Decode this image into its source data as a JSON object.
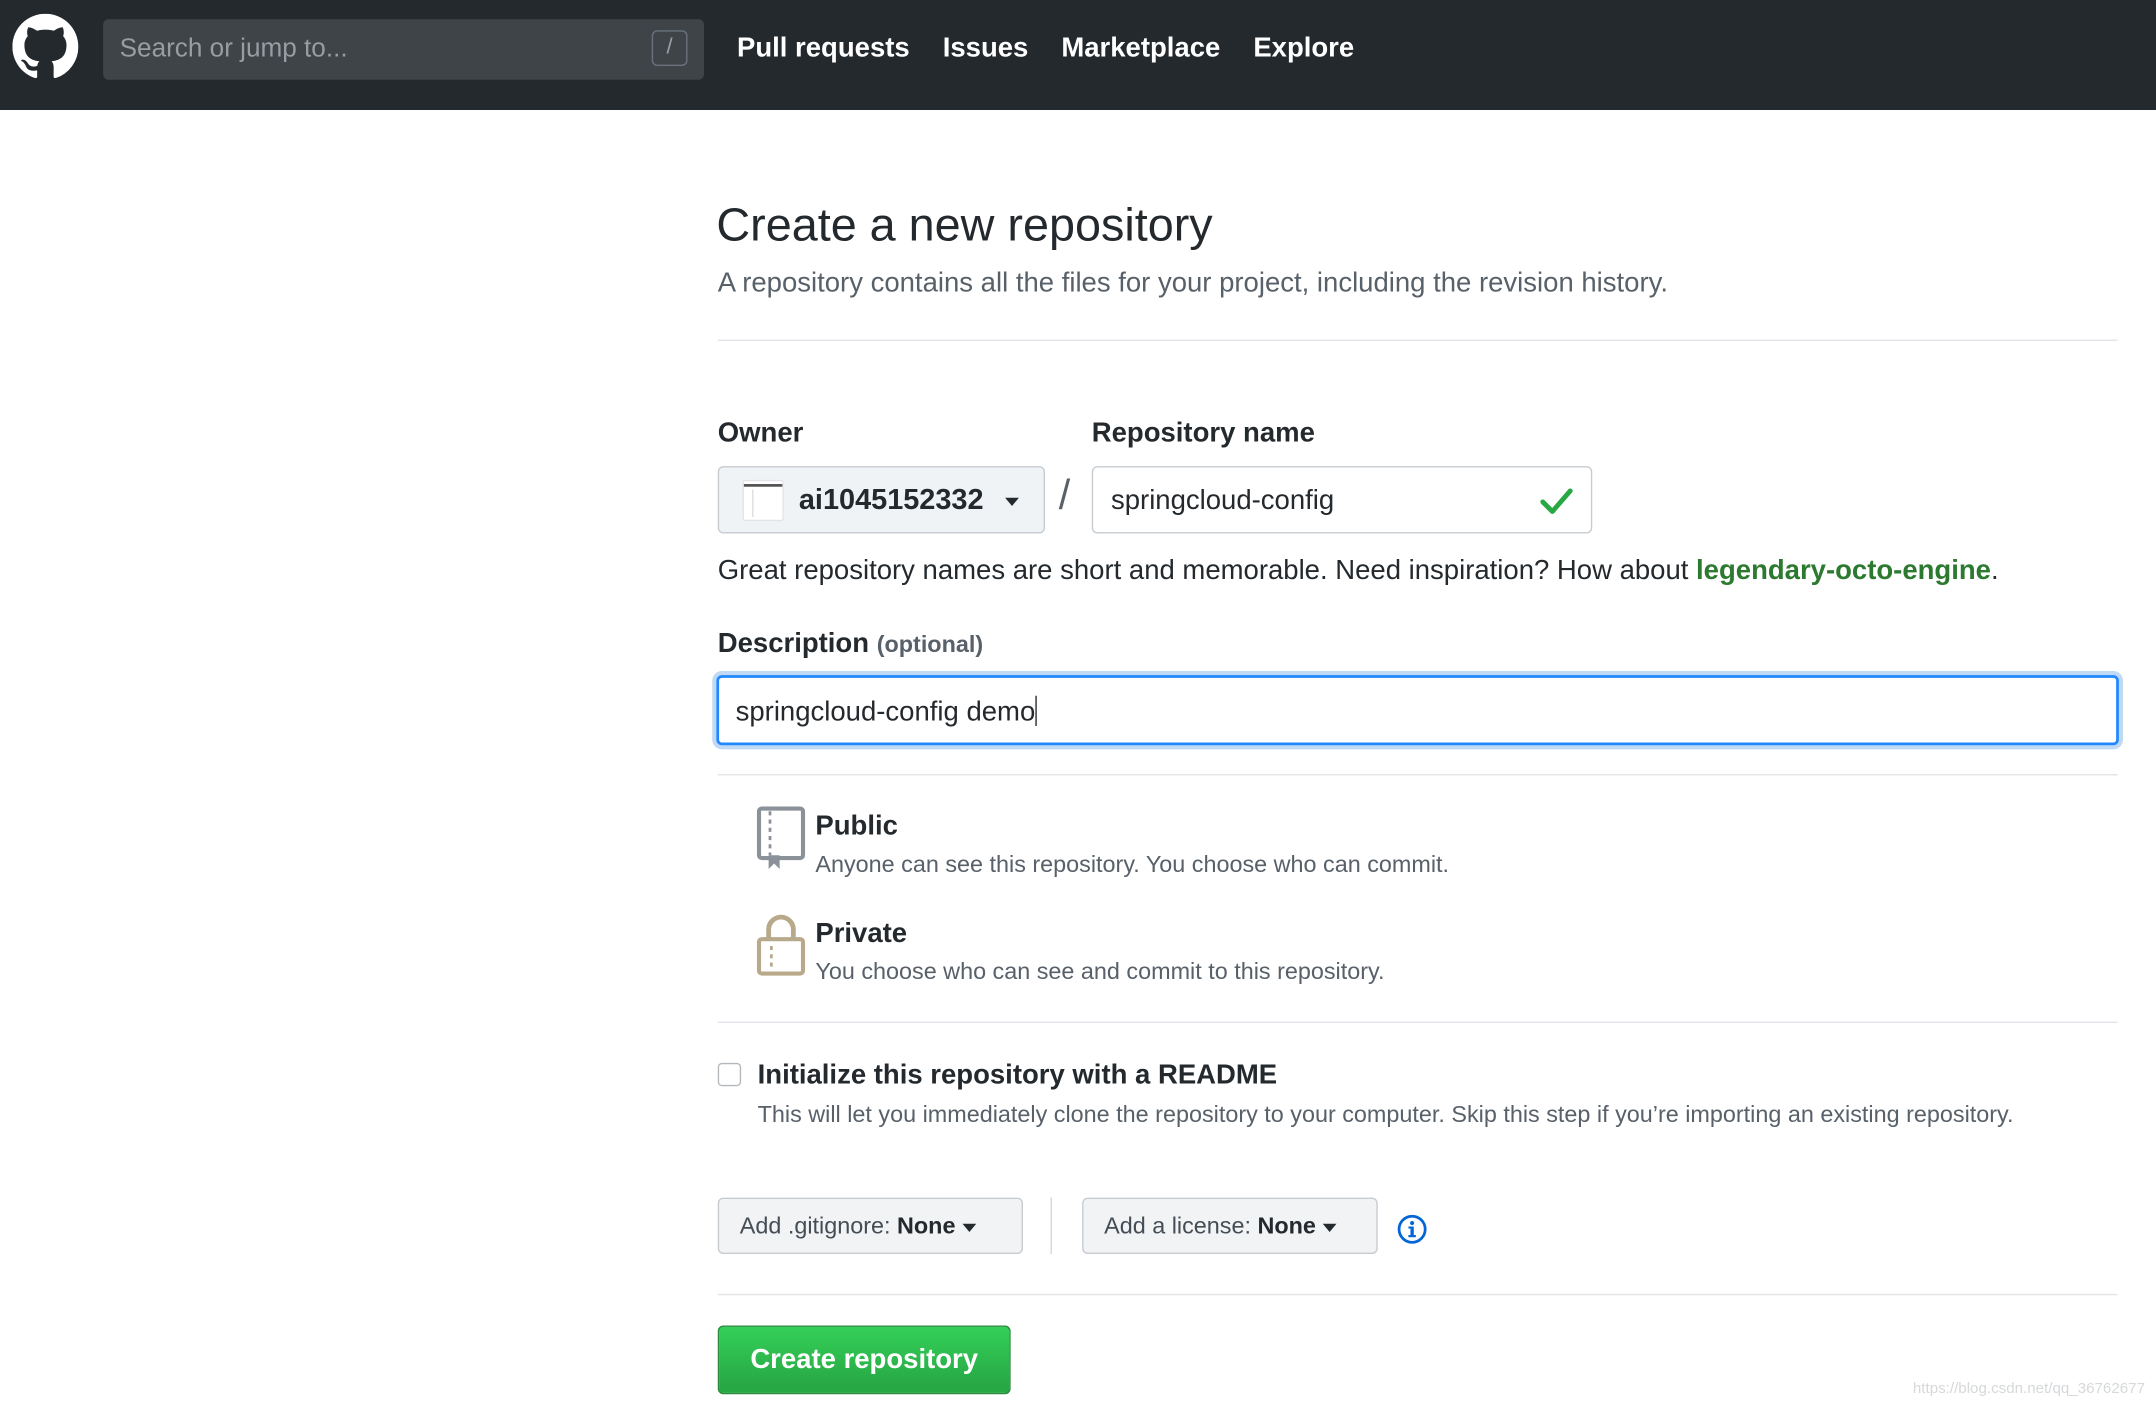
{
  "header": {
    "search_placeholder": "Search or jump to...",
    "search_shortcut": "/",
    "nav": [
      "Pull requests",
      "Issues",
      "Marketplace",
      "Explore"
    ]
  },
  "page": {
    "title": "Create a new repository",
    "subtitle": "A repository contains all the files for your project, including the revision history."
  },
  "form": {
    "owner_label": "Owner",
    "owner_value": "ai1045152332",
    "separator": "/",
    "repo_label": "Repository name",
    "repo_value": "springcloud-config",
    "hint_text": "Great repository names are short and memorable. Need inspiration? How about ",
    "suggestion": "legendary-octo-engine",
    "hint_end": ".",
    "description_label": "Description",
    "description_optional": "(optional)",
    "description_value": "springcloud-config demo"
  },
  "visibility": {
    "public_title": "Public",
    "public_desc": "Anyone can see this repository. You choose who can commit.",
    "private_title": "Private",
    "private_desc": "You choose who can see and commit to this repository."
  },
  "readme": {
    "title": "Initialize this repository with a README",
    "desc": "This will let you immediately clone the repository to your computer. Skip this step if you’re importing an existing repository."
  },
  "options": {
    "gitignore_label": "Add .gitignore:",
    "gitignore_value": "None",
    "license_label": "Add a license:",
    "license_value": "None"
  },
  "actions": {
    "create_label": "Create repository"
  },
  "watermark": "https://blog.csdn.net/qq_36762677",
  "colors": {
    "header_bg": "#24292e",
    "accent_green": "#28a745",
    "suggestion_green": "#2c7a2f",
    "focus_blue": "#2188ff"
  }
}
